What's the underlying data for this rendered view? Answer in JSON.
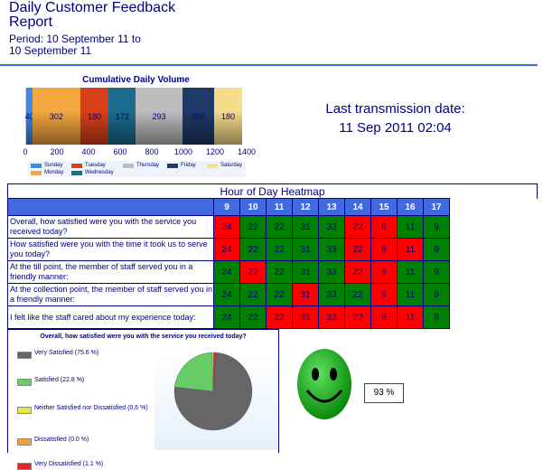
{
  "header": {
    "title": "Daily Customer Feedback Report",
    "period": "Period: 10 September 11 to 10 September 11"
  },
  "volume_chart": {
    "title": "Cumulative Daily Volume",
    "xlim": [
      0,
      1400
    ],
    "ticks": [
      "0",
      "200",
      "400",
      "600",
      "800",
      "1000",
      "1200",
      "1400"
    ],
    "segments": [
      {
        "day": "Sunday",
        "value": 40,
        "color": "#3d8ae8"
      },
      {
        "day": "Monday",
        "value": 302,
        "color": "#f5a840"
      },
      {
        "day": "Tuesday",
        "value": 180,
        "color": "#d8401a"
      },
      {
        "day": "Wednesday",
        "value": 172,
        "color": "#1b6c8e"
      },
      {
        "day": "Thursday",
        "value": 293,
        "color": "#bdbdbd"
      },
      {
        "day": "Friday",
        "value": 200,
        "color": "#1f3a66"
      },
      {
        "day": "Saturday",
        "value": 180,
        "color": "#f7dc8a"
      }
    ],
    "legend": [
      "Sunday",
      "Tuesday",
      "Thursday",
      "Friday",
      "Saturday",
      "Monday",
      "Wednesday"
    ]
  },
  "transmission": {
    "label": "Last transmission date:",
    "value": "11 Sep 2011 02:04"
  },
  "heatmap": {
    "title": "Hour of Day Heatmap",
    "hours": [
      "9",
      "10",
      "11",
      "12",
      "13",
      "14",
      "15",
      "16",
      "17"
    ],
    "colors": {
      "red": "#ff0000",
      "green": "#008000"
    },
    "rows": [
      {
        "question": "Overall, how satisfied were you with the service you received today?",
        "values": [
          "24",
          "22",
          "22",
          "31",
          "33",
          "22",
          "6",
          "11",
          "9"
        ],
        "status": [
          "r",
          "g",
          "g",
          "g",
          "g",
          "r",
          "r",
          "g",
          "g"
        ]
      },
      {
        "question": "How satisfied were you with the time it took us to serve you today?",
        "values": [
          "24",
          "22",
          "22",
          "31",
          "33",
          "22",
          "6",
          "11",
          "9"
        ],
        "status": [
          "r",
          "g",
          "g",
          "g",
          "g",
          "r",
          "r",
          "r",
          "g"
        ]
      },
      {
        "question": "At the till point, the member of staff served you in a friendly manner:",
        "values": [
          "24",
          "22",
          "22",
          "31",
          "33",
          "22",
          "6",
          "11",
          "9"
        ],
        "status": [
          "g",
          "r",
          "g",
          "g",
          "g",
          "r",
          "r",
          "g",
          "g"
        ]
      },
      {
        "question": "At the collection point, the member of staff served you in a friendly manner:",
        "values": [
          "24",
          "22",
          "22",
          "31",
          "33",
          "22",
          "6",
          "11",
          "9"
        ],
        "status": [
          "g",
          "g",
          "g",
          "r",
          "g",
          "g",
          "r",
          "g",
          "g"
        ]
      },
      {
        "question": "I felt like the staff cared about my experience today:",
        "values": [
          "24",
          "22",
          "22",
          "31",
          "33",
          "22",
          "6",
          "11",
          "9"
        ],
        "status": [
          "g",
          "g",
          "r",
          "r",
          "r",
          "r",
          "r",
          "r",
          "g"
        ]
      }
    ]
  },
  "pie_chart": {
    "title": "Overall, how satisfied were you with the service you received today?",
    "slices": [
      {
        "label": "Very Satisfied (75.6 %)",
        "value": 75.6,
        "color": "#666666"
      },
      {
        "label": "Satisfied (22.8 %)",
        "value": 22.8,
        "color": "#66cc66"
      },
      {
        "label": "Neither Satisfied nor Dissatisfied (0.6 %)",
        "value": 0.6,
        "color": "#e8e840"
      },
      {
        "label": "Dissatisfied (0.0 %)",
        "value": 0.0,
        "color": "#f0a040"
      },
      {
        "label": "Very Dissatisfied (1.1 %)",
        "value": 1.1,
        "color": "#ee2222"
      }
    ]
  },
  "score": {
    "value": "93 %",
    "icon": "smiley-face-icon"
  }
}
